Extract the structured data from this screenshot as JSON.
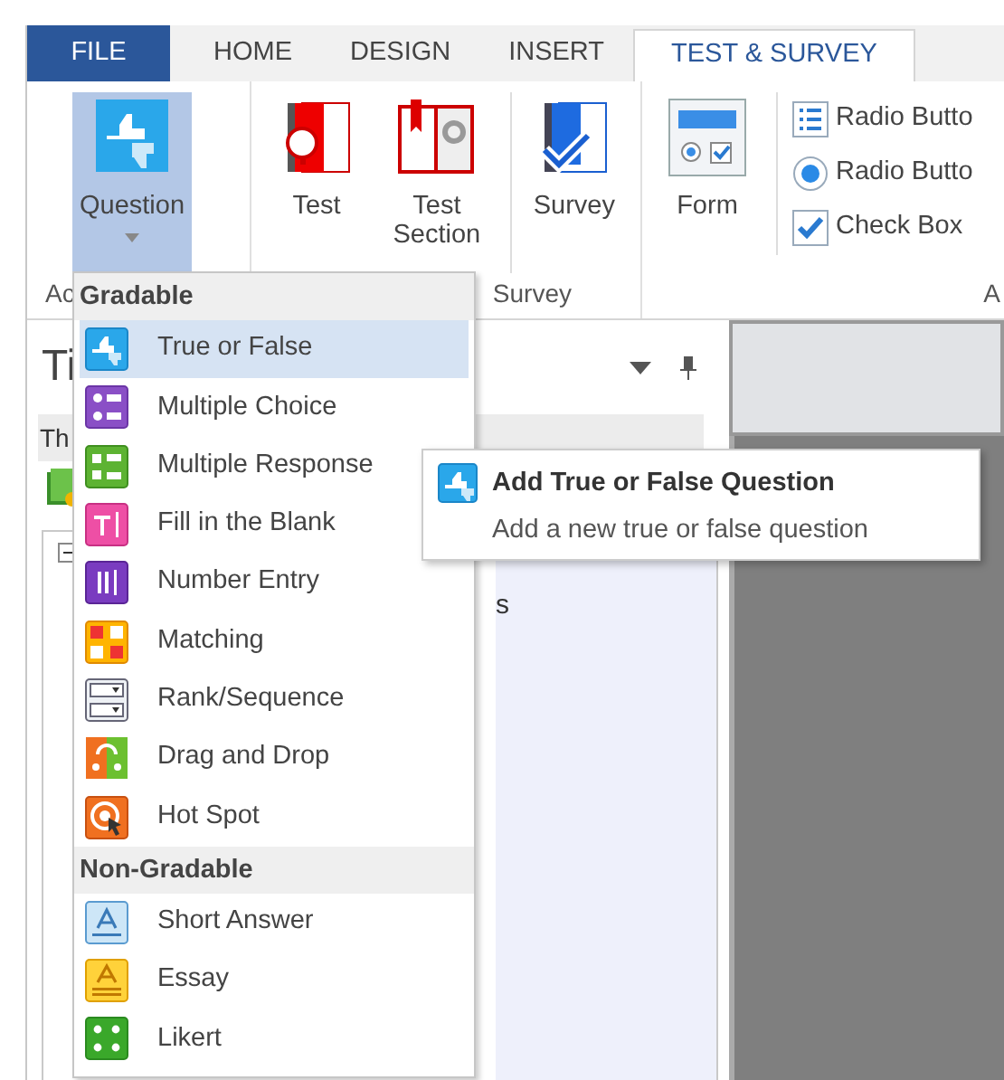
{
  "tabs": [
    {
      "label": "FILE",
      "kind": "file",
      "selected": false
    },
    {
      "label": "HOME",
      "kind": "tab",
      "selected": false
    },
    {
      "label": "DESIGN",
      "kind": "tab",
      "selected": false
    },
    {
      "label": "INSERT",
      "kind": "tab",
      "selected": false
    },
    {
      "label": "TEST & SURVEY",
      "kind": "tab",
      "selected": true
    }
  ],
  "ribbon": {
    "groups": [
      {
        "label": "Ac",
        "large_buttons": [
          {
            "label": "Question",
            "kind": "question",
            "selected": true,
            "dropdown": true
          }
        ]
      },
      {
        "label": "Survey",
        "large_buttons": [
          {
            "label": "Test",
            "kind": "test",
            "selected": false
          },
          {
            "label": "Test Section",
            "kind": "test-section",
            "selected": false
          },
          {
            "label": "Survey",
            "kind": "survey",
            "selected": false
          }
        ]
      },
      {
        "label": "A",
        "large_buttons": [
          {
            "label": "Form",
            "kind": "form",
            "selected": false
          }
        ],
        "small_buttons": [
          {
            "label": "Radio Butto",
            "kind": "list"
          },
          {
            "label": "Radio Butto",
            "kind": "radio"
          },
          {
            "label": "Check Box",
            "kind": "checkbox"
          }
        ]
      }
    ]
  },
  "left_pane": {
    "title": "Ti",
    "row_label": "Th",
    "tree_text": "s"
  },
  "question_menu": {
    "sections": [
      {
        "title": "Gradable",
        "items": [
          {
            "label": "True or False",
            "kind": "true-false",
            "selected": true
          },
          {
            "label": "Multiple Choice",
            "kind": "multiple-choice",
            "selected": false
          },
          {
            "label": "Multiple Response",
            "kind": "multiple-response",
            "selected": false
          },
          {
            "label": "Fill in the Blank",
            "kind": "fill-blank",
            "selected": false
          },
          {
            "label": "Number Entry",
            "kind": "number-entry",
            "selected": false
          },
          {
            "label": "Matching",
            "kind": "matching",
            "selected": false
          },
          {
            "label": "Rank/Sequence",
            "kind": "rank",
            "selected": false
          },
          {
            "label": "Drag and Drop",
            "kind": "drag-drop",
            "selected": false
          },
          {
            "label": "Hot Spot",
            "kind": "hot-spot",
            "selected": false
          }
        ]
      },
      {
        "title": "Non-Gradable",
        "items": [
          {
            "label": "Short Answer",
            "kind": "short-answer",
            "selected": false
          },
          {
            "label": "Essay",
            "kind": "essay",
            "selected": false
          },
          {
            "label": "Likert",
            "kind": "likert",
            "selected": false
          }
        ]
      }
    ]
  },
  "tooltip": {
    "title": "Add True or False Question",
    "description": "Add a new true or false question"
  }
}
